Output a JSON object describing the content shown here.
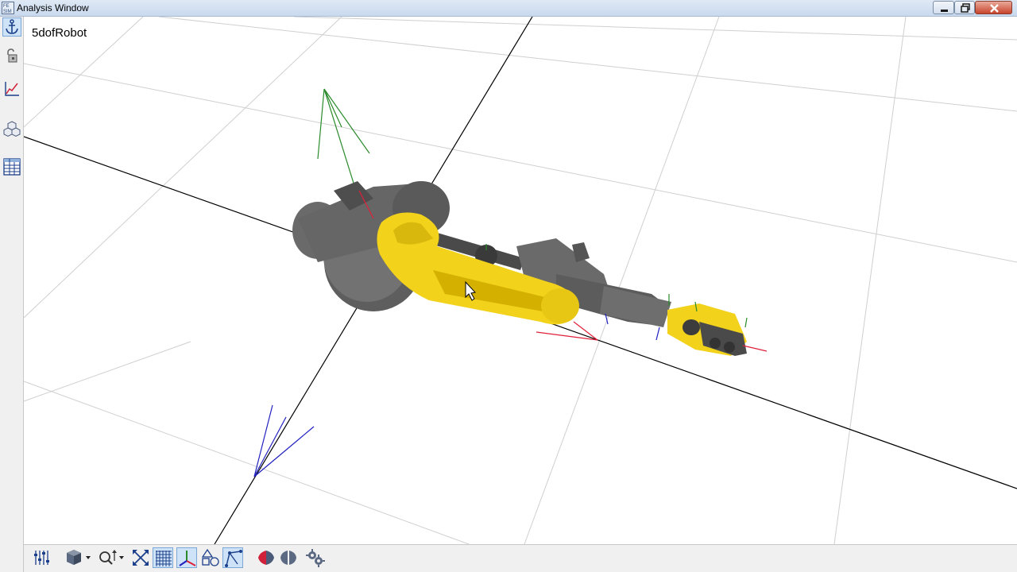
{
  "window": {
    "title": "Analysis Window",
    "app_icon": "sim-icon",
    "controls": [
      "minimize-icon",
      "restore-icon",
      "close-icon"
    ]
  },
  "left_toolbar": {
    "items": [
      {
        "name": "anchor-icon",
        "active": true
      },
      {
        "name": "lock-icon",
        "active": false
      },
      {
        "name": "graph-icon",
        "active": false
      },
      {
        "name": "bodies-icon",
        "active": false
      },
      {
        "name": "table-icon",
        "active": false
      }
    ]
  },
  "viewport": {
    "model_name": "5dofRobot",
    "colors": {
      "grid": "#cfcfcf",
      "axis": "#000000",
      "body_gray": "#6e6e6e",
      "body_yellow": "#f2d21a",
      "frame_x": "#e0203a",
      "frame_y": "#2a8a2a",
      "frame_z": "#2020c0"
    }
  },
  "bottom_toolbar": {
    "items": [
      {
        "name": "sliders-icon",
        "active": false
      },
      {
        "name": "view-cube-dropdown-icon",
        "active": false
      },
      {
        "name": "zoom-dropdown-icon",
        "active": false
      },
      {
        "name": "fit-view-icon",
        "active": false
      },
      {
        "name": "grid-toggle-icon",
        "active": true
      },
      {
        "name": "axes-toggle-icon",
        "active": true
      },
      {
        "name": "shapes-toggle-icon",
        "active": false
      },
      {
        "name": "frames-toggle-icon",
        "active": true
      },
      {
        "name": "shaded-mode-icon",
        "active": false
      },
      {
        "name": "mirror-mode-icon",
        "active": false
      },
      {
        "name": "gears-icon",
        "active": false
      }
    ]
  }
}
